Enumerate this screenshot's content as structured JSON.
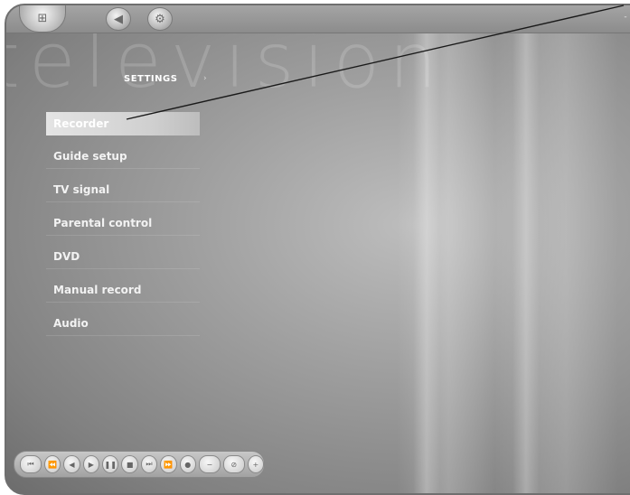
{
  "window": {
    "watermark": "television",
    "controls": "- ▫ ×"
  },
  "nav": {
    "icons": [
      "media-center-logo-icon",
      "back-icon",
      "settings-icon"
    ]
  },
  "page": {
    "title": "SETTINGS",
    "title_arrow": "›"
  },
  "menu": {
    "items": [
      {
        "label": "Recorder",
        "selected": true
      },
      {
        "label": "Guide setup",
        "selected": false
      },
      {
        "label": "TV signal",
        "selected": false
      },
      {
        "label": "Parental control",
        "selected": false
      },
      {
        "label": "DVD",
        "selected": false
      },
      {
        "label": "Manual record",
        "selected": false
      },
      {
        "label": "Audio",
        "selected": false
      }
    ]
  },
  "transport": {
    "buttons": [
      "previous-icon",
      "rewind-icon",
      "back-icon",
      "play-icon",
      "pause-icon",
      "stop-icon",
      "skip-icon",
      "fast-forward-icon",
      "record-icon",
      "volume-down-icon",
      "mute-icon",
      "volume-up-icon"
    ]
  }
}
